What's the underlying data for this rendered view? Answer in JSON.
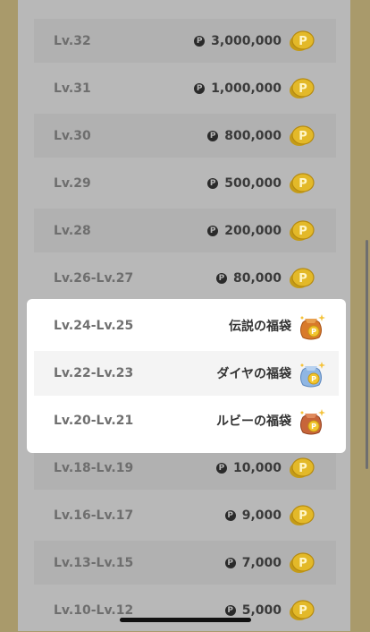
{
  "reward_rows_top": [
    {
      "level": "Lv.32",
      "amount": "3,000,000"
    },
    {
      "level": "Lv.31",
      "amount": "1,000,000"
    },
    {
      "level": "Lv.30",
      "amount": "800,000"
    },
    {
      "level": "Lv.29",
      "amount": "500,000"
    },
    {
      "level": "Lv.28",
      "amount": "200,000"
    },
    {
      "level": "Lv.26-Lv.27",
      "amount": "80,000"
    }
  ],
  "highlighted_rows": [
    {
      "level": "Lv.24-Lv.25",
      "reward": "伝説の福袋",
      "icon": "legend-bag-icon",
      "bag_color": "#d87a2a"
    },
    {
      "level": "Lv.22-Lv.23",
      "reward": "ダイヤの福袋",
      "icon": "diamond-bag-icon",
      "bag_color": "#8fb6e3"
    },
    {
      "level": "Lv.20-Lv.21",
      "reward": "ルビーの福袋",
      "icon": "ruby-bag-icon",
      "bag_color": "#c7653a"
    }
  ],
  "reward_rows_bottom": [
    {
      "level": "Lv.18-Lv.19",
      "amount": "10,000"
    },
    {
      "level": "Lv.16-Lv.17",
      "amount": "9,000"
    },
    {
      "level": "Lv.13-Lv.15",
      "amount": "7,000"
    },
    {
      "level": "Lv.10-Lv.12",
      "amount": "5,000"
    }
  ],
  "currency_badge": "P",
  "coin_icon": "point-coin-icon"
}
